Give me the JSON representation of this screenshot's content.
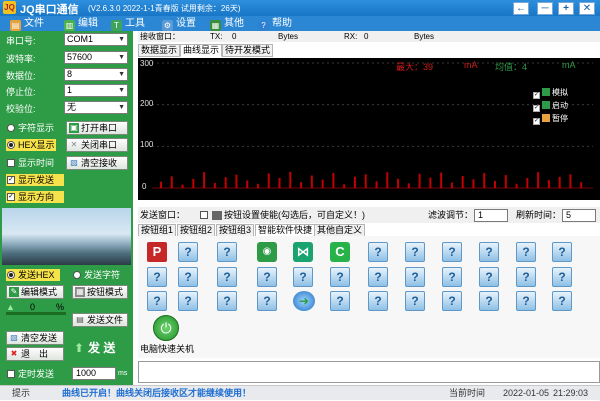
{
  "window": {
    "app_title": "JQ串口通信",
    "version_info": "(V2.6.3.0 2022-1-1青春版 试用剩余：26天)",
    "logo_text": "JQ",
    "buttons": [
      "←",
      "─",
      "+",
      "✕"
    ]
  },
  "menu": [
    {
      "label": "文件",
      "icon": "file-icon",
      "color": "#e6a23c"
    },
    {
      "label": "编辑",
      "icon": "edit-icon",
      "color": "#4caf50"
    },
    {
      "label": "工具",
      "icon": "tool-icon",
      "color": "#3da35d"
    },
    {
      "label": "设置",
      "icon": "gear-icon",
      "color": "#5b9bd5"
    },
    {
      "label": "其他",
      "icon": "grid-icon",
      "color": "#3a8d3a"
    },
    {
      "label": "帮助",
      "icon": "help-icon",
      "color": "#2f7fd3"
    }
  ],
  "serial": {
    "port_label": "串口号:",
    "port_value": "COM1",
    "baud_label": "波特率:",
    "baud_value": "57600",
    "databits_label": "数据位:",
    "databits_value": "8",
    "stopbits_label": "停止位:",
    "stopbits_value": "1",
    "parity_label": "校验位:",
    "parity_value": "无"
  },
  "left_panel": {
    "char_display": "字符显示",
    "hex_display": "HEX显示",
    "open_port": "打开串口",
    "close_port": "关闭串口",
    "show_time": "显示时间",
    "clear_rx": "清空接收",
    "show_send": "显示发送",
    "show_direction": "显示方向",
    "send_hex": "发送HEX",
    "send_string": "发送字符",
    "edit_mode": "编辑模式",
    "button_mode": "按钮模式",
    "counter_value": "0",
    "percent": "%",
    "send_file": "发送文件",
    "clear_send": "清空发送",
    "exit": "退　出",
    "send": "发 送",
    "timed_send": "定时发送",
    "interval_value": "1000",
    "interval_unit": "ms"
  },
  "receive_header": {
    "label": "接收窗口：",
    "tx_label": "TX:",
    "tx_value": "0",
    "tx_unit": "Bytes",
    "rx_label": "RX:",
    "rx_value": "0",
    "rx_unit": "Bytes"
  },
  "receive_tabs": [
    "数据显示",
    "曲线显示",
    "待开发模式"
  ],
  "chart_data": {
    "type": "bar",
    "ylim": [
      0,
      300
    ],
    "yticks": [
      "300",
      "200",
      "100",
      "0"
    ],
    "max_label": "最大：39",
    "max_unit": "mA",
    "avg_label": "均值：4",
    "avg_unit": "mA",
    "grid": true,
    "legend_placement": "right",
    "legend": [
      {
        "name": "模拟",
        "color": "#2e9b47"
      },
      {
        "name": "启动",
        "color": "#2e9b47"
      },
      {
        "name": "暂停",
        "color": "#e6a23c"
      }
    ],
    "bar_color": "#c40000",
    "values": [
      15,
      28,
      8,
      22,
      38,
      12,
      26,
      32,
      18,
      10,
      35,
      24,
      39,
      14,
      30,
      20,
      36,
      9,
      27,
      33,
      16,
      38,
      22,
      11,
      34,
      25,
      37,
      13,
      29,
      21,
      36,
      17,
      31,
      10,
      24,
      38,
      19,
      27,
      33,
      14
    ]
  },
  "send_bar": {
    "label": "发送窗口：",
    "button_enable": "按钮设置使能(勾选后，可自定义！)",
    "filter_label": "滤波调节：",
    "filter_value": "1",
    "refresh_label": "刷新时间：",
    "refresh_value": "5"
  },
  "button_tabs": [
    "按钮组1",
    "按钮组2",
    "按钮组3",
    "智能软件快捷",
    "其他自定义"
  ],
  "shortcut": {
    "label": "电脑快速关机"
  },
  "status": {
    "hint_label": "提示",
    "hint_text": "曲线已开启！曲线关闭后接收区才能继续使用！",
    "time_label": "当前时间",
    "date_value": "2022-01-05",
    "time_value": "21:29:03"
  }
}
